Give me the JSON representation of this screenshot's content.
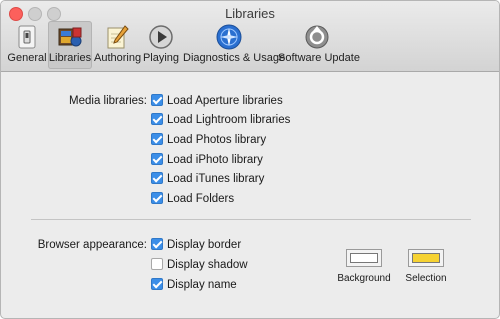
{
  "window": {
    "title": "Libraries"
  },
  "toolbar": {
    "tabs": [
      {
        "label": "General",
        "icon": "general-switch-icon",
        "selected": false
      },
      {
        "label": "Libraries",
        "icon": "libraries-icon",
        "selected": true
      },
      {
        "label": "Authoring",
        "icon": "pencil-pad-icon",
        "selected": false
      },
      {
        "label": "Playing",
        "icon": "play-icon",
        "selected": false
      },
      {
        "label": "Diagnostics & Usage",
        "icon": "diagnostics-compass-icon",
        "selected": false
      },
      {
        "label": "Software Update",
        "icon": "software-update-icon",
        "selected": false
      }
    ]
  },
  "media": {
    "label": "Media libraries:",
    "options": [
      {
        "label": "Load Aperture libraries",
        "checked": true
      },
      {
        "label": "Load Lightroom libraries",
        "checked": true
      },
      {
        "label": "Load Photos library",
        "checked": true
      },
      {
        "label": "Load iPhoto library",
        "checked": true
      },
      {
        "label": "Load iTunes library",
        "checked": true
      },
      {
        "label": "Load Folders",
        "checked": true
      }
    ]
  },
  "browser": {
    "label": "Browser appearance:",
    "options": [
      {
        "label": "Display border",
        "checked": true
      },
      {
        "label": "Display shadow",
        "checked": false
      },
      {
        "label": "Display name",
        "checked": true
      }
    ],
    "background": {
      "label": "Background",
      "color": "#ffffff"
    },
    "selection": {
      "label": "Selection",
      "color": "#f6d232"
    }
  },
  "colors": {
    "accent": "#3b8ee8",
    "close": "#fc605c"
  }
}
